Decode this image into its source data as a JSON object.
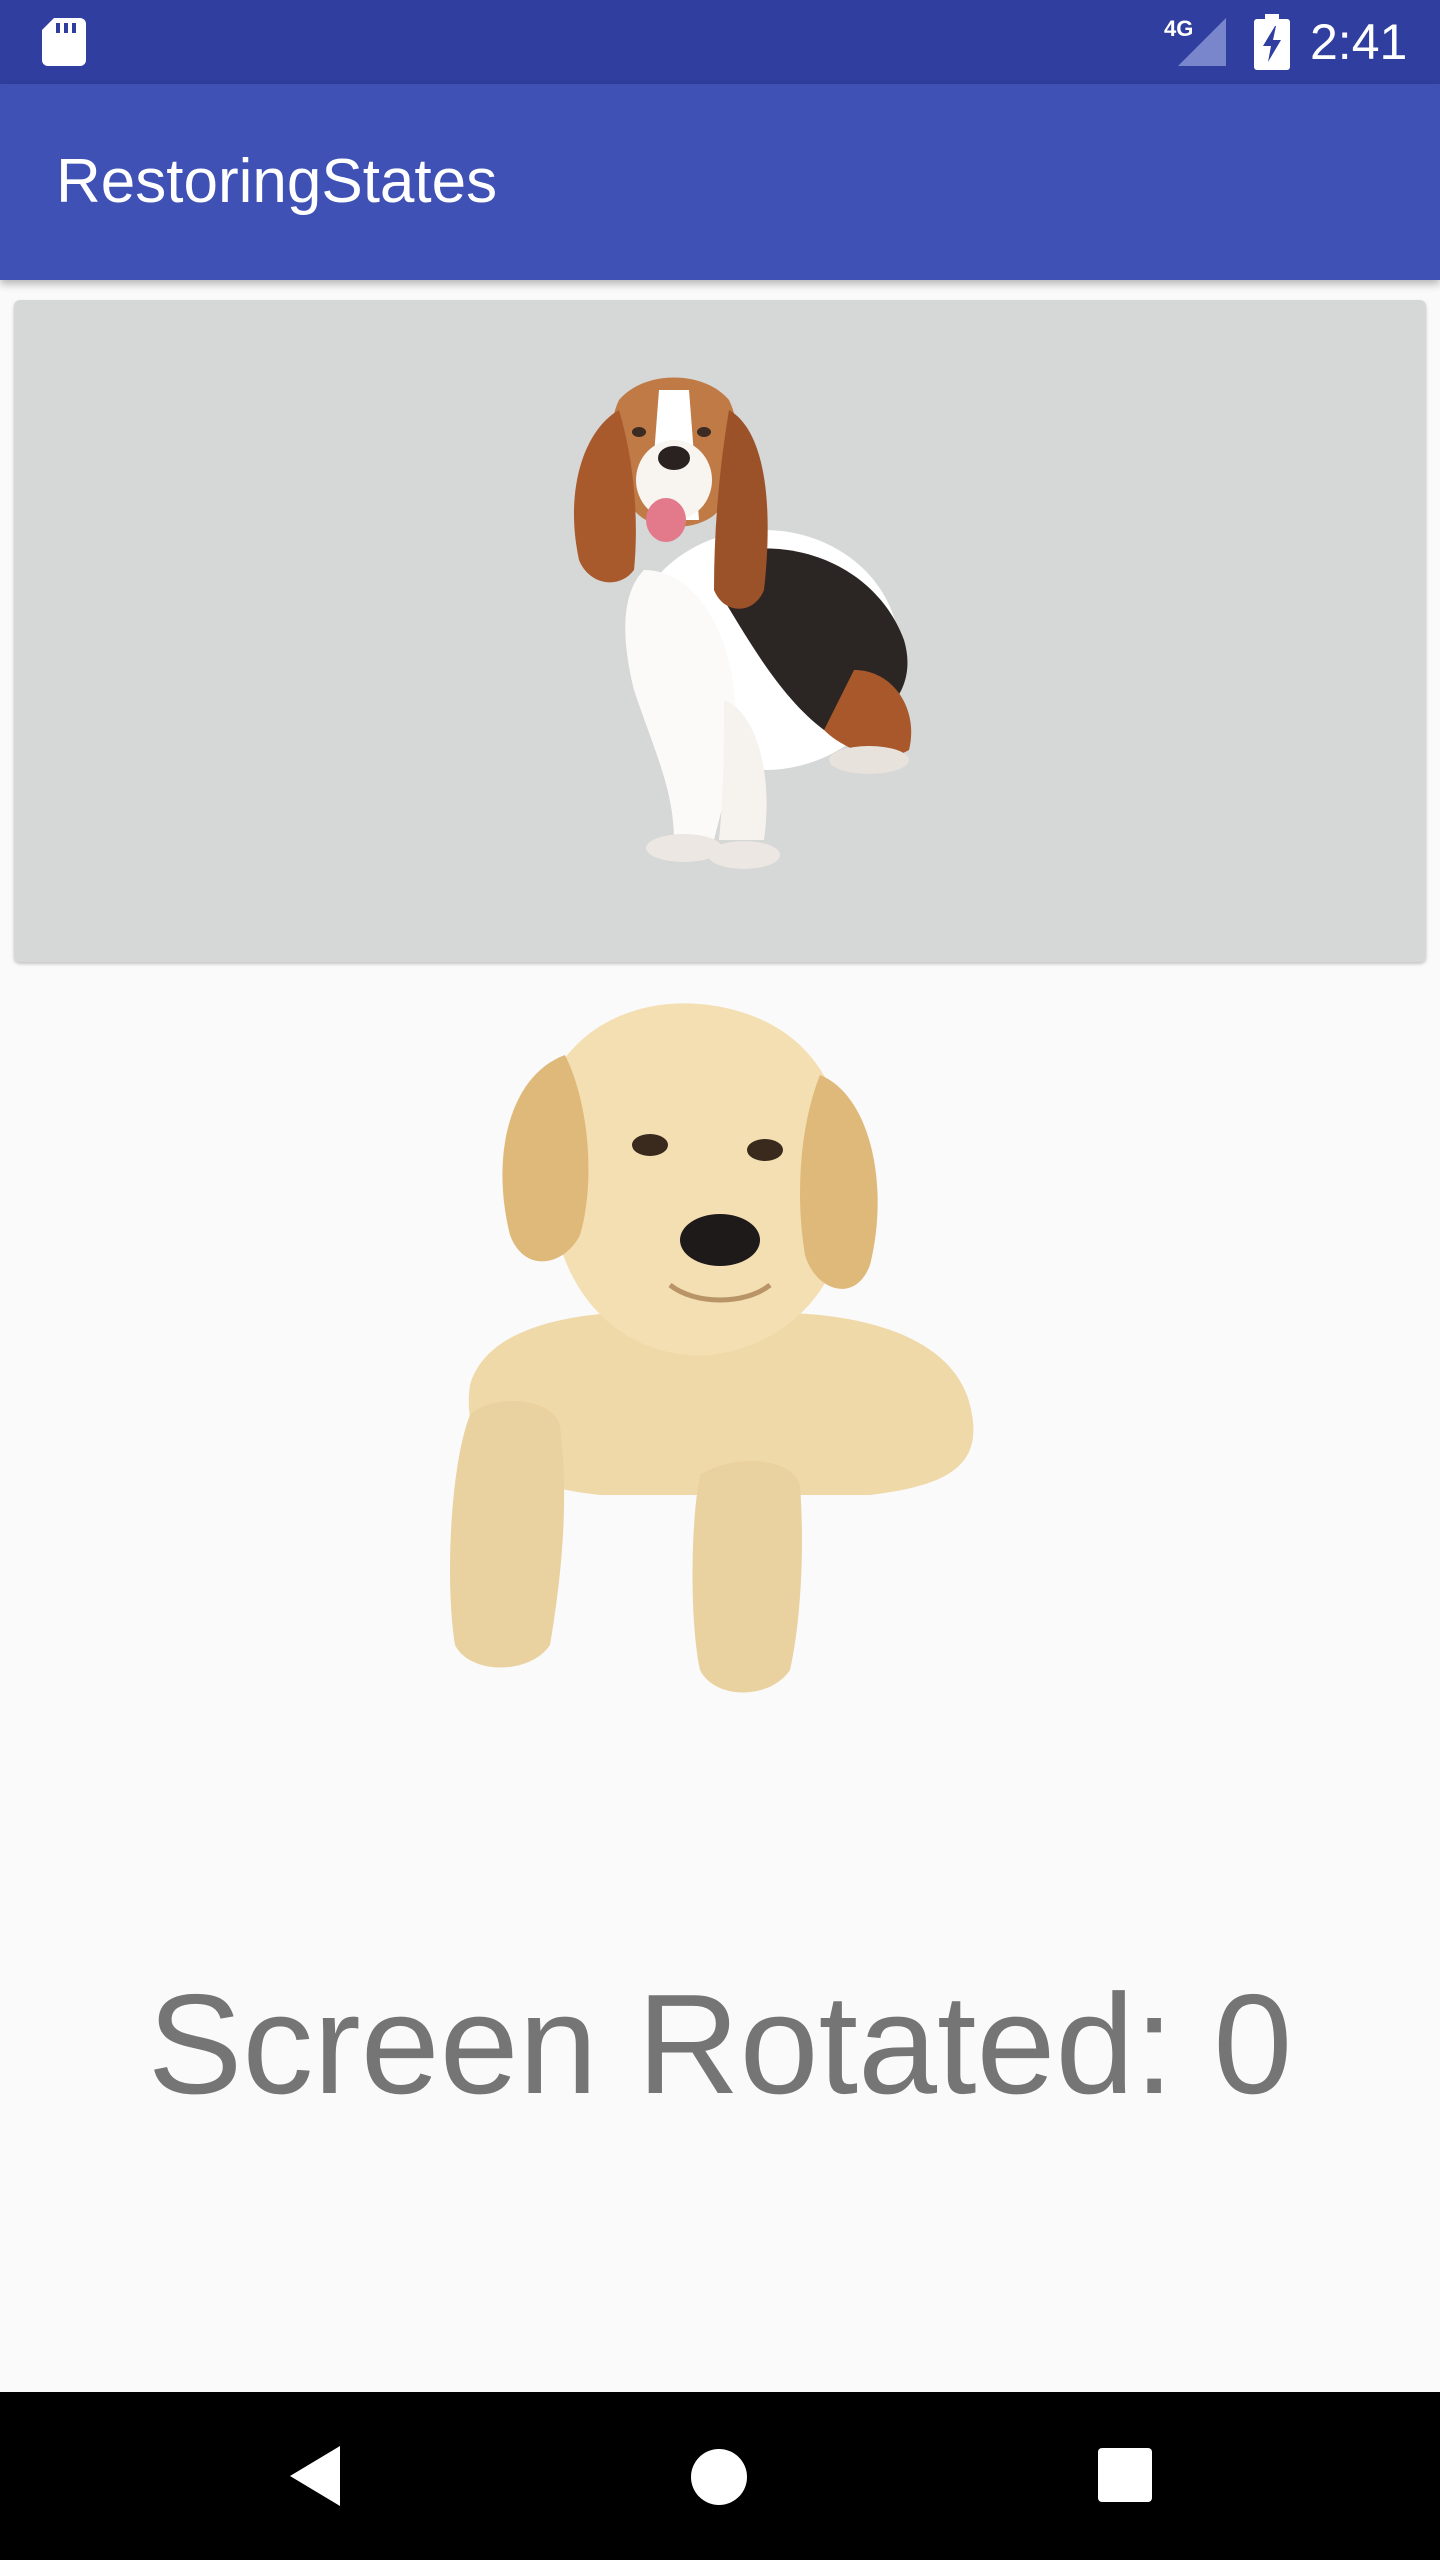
{
  "status_bar": {
    "time": "2:41",
    "network_label": "4G",
    "icons": [
      "sd-card-icon",
      "cell-signal-icon",
      "battery-charging-icon"
    ]
  },
  "app_bar": {
    "title": "RestoringStates"
  },
  "main": {
    "image_button": {
      "image": "basset-hound-dog"
    },
    "image_view": {
      "image": "golden-retriever-puppy"
    },
    "rotation_text": "Screen Rotated: 0"
  },
  "navigation_bar": {
    "buttons": [
      "back-icon",
      "home-icon",
      "recents-icon"
    ]
  },
  "colors": {
    "status_bar": "#303f9f",
    "app_bar": "#3f51b5",
    "button_bg": "#d6d7d7",
    "background": "#fafafa",
    "text_gray": "#757575",
    "nav_bar": "#000000"
  }
}
